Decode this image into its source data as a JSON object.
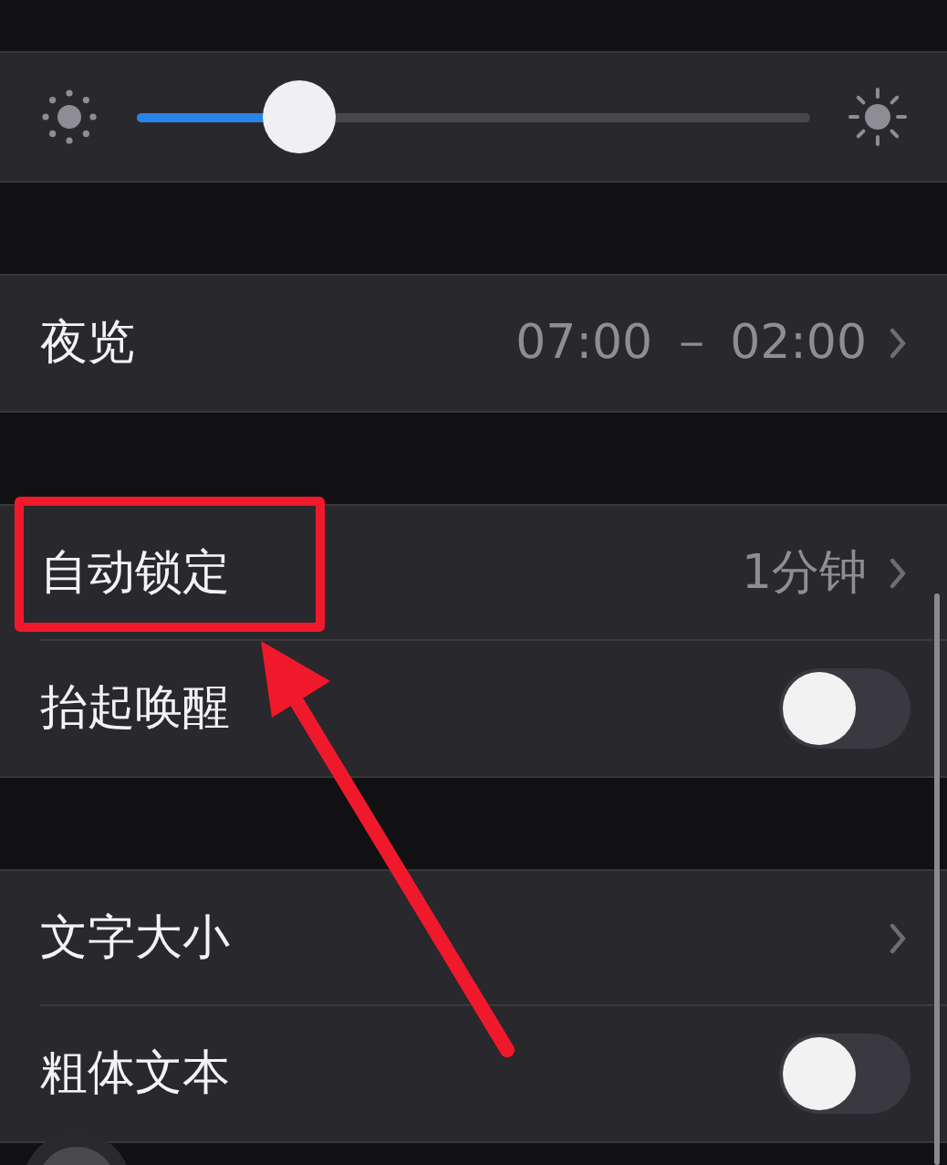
{
  "brightness": {
    "level": 0.24
  },
  "sections": [
    {
      "rows": [
        {
          "kind": "link",
          "label": "夜览",
          "value": "07:00 － 02:00"
        }
      ]
    },
    {
      "rows": [
        {
          "kind": "link",
          "label": "自动锁定",
          "value": "1分钟"
        },
        {
          "kind": "toggle",
          "label": "抬起唤醒",
          "on": false
        }
      ]
    },
    {
      "rows": [
        {
          "kind": "link",
          "label": "文字大小"
        },
        {
          "kind": "toggle",
          "label": "粗体文本",
          "on": false
        }
      ]
    }
  ]
}
